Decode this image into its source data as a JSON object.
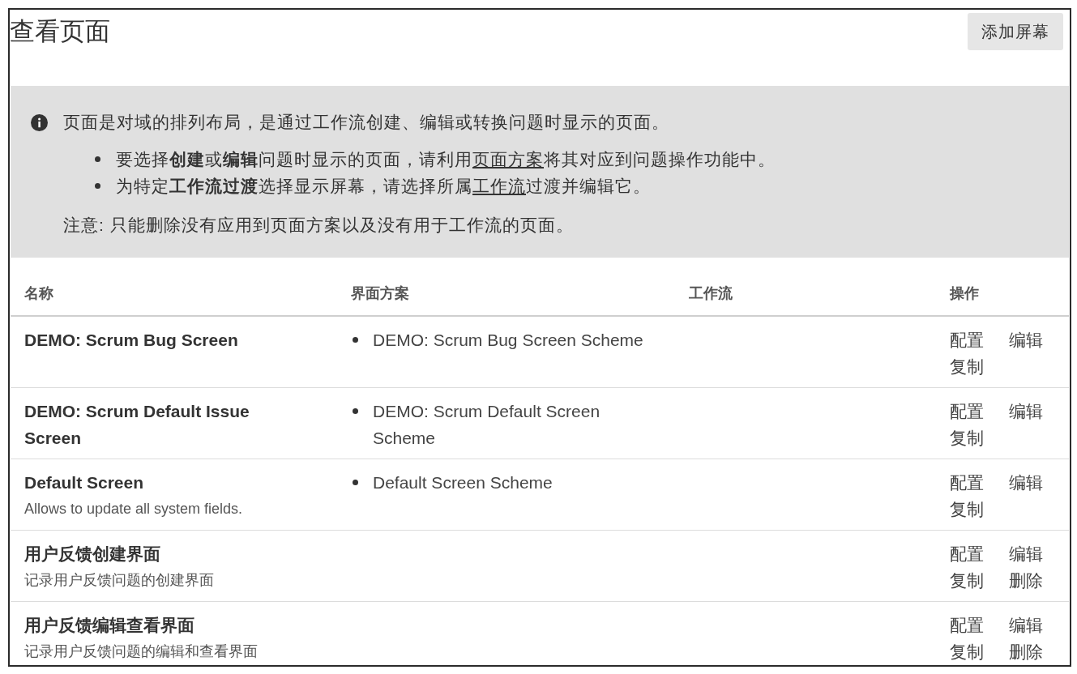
{
  "page": {
    "title": "查看页面",
    "add_button": "添加屏幕"
  },
  "info": {
    "intro": "页面是对域的排列布局，是通过工作流创建、编辑或转换问题时显示的页面。",
    "bullets": [
      {
        "segments": [
          {
            "kind": "text",
            "text": "要选择**创建**或**编辑**问题时显示的页面，请利用"
          },
          {
            "kind": "link",
            "text": "页面方案"
          },
          {
            "kind": "text",
            "text": "将其对应到问题操作功能中。"
          }
        ]
      },
      {
        "segments": [
          {
            "kind": "text",
            "text": "为特定**工作流过渡**选择显示屏幕，请选择所属"
          },
          {
            "kind": "link",
            "text": "工作流"
          },
          {
            "kind": "text",
            "text": "过渡并编辑它。"
          }
        ]
      }
    ],
    "note": "注意: 只能删除没有应用到页面方案以及没有用于工作流的页面。"
  },
  "table": {
    "columns": [
      "名称",
      "界面方案",
      "工作流",
      "操作"
    ],
    "rows": [
      {
        "name": "DEMO: Scrum Bug Screen",
        "schemes": [
          "DEMO: Scrum Bug Screen Scheme"
        ],
        "actions": [
          "配置",
          "编辑",
          "复制"
        ]
      },
      {
        "name": "DEMO: Scrum Default Issue Screen",
        "schemes": [
          "DEMO: Scrum Default Screen Scheme"
        ],
        "actions": [
          "配置",
          "编辑",
          "复制"
        ]
      },
      {
        "name": "Default Screen",
        "description": "Allows to update all system fields.",
        "schemes": [
          "Default Screen Scheme"
        ],
        "actions": [
          "配置",
          "编辑",
          "复制"
        ]
      },
      {
        "name": "用户反馈创建界面",
        "description": "记录用户反馈问题的创建界面",
        "schemes": [],
        "actions": [
          "配置",
          "编辑",
          "复制",
          "删除"
        ]
      },
      {
        "name": "用户反馈编辑查看界面",
        "description": "记录用户反馈问题的编辑和查看界面",
        "schemes": [],
        "actions": [
          "配置",
          "编辑",
          "复制",
          "删除"
        ]
      }
    ]
  }
}
